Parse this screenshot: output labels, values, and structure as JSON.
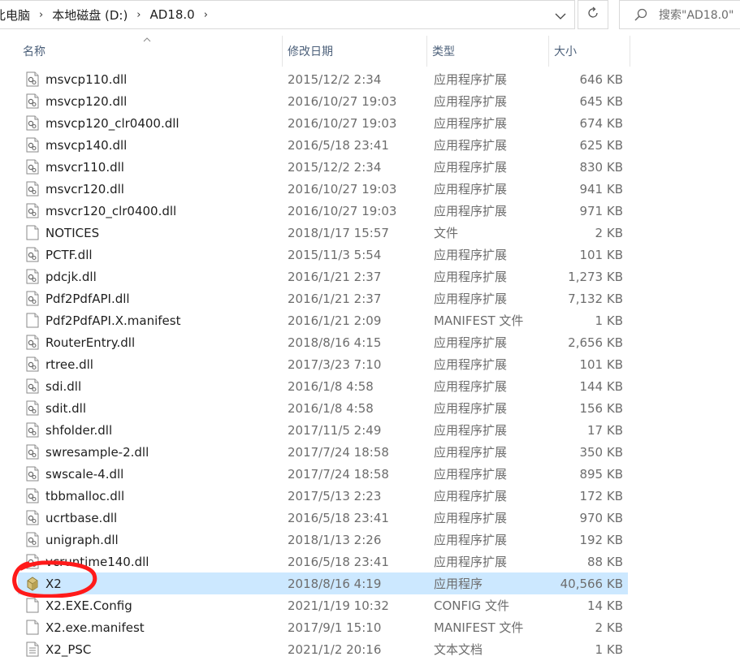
{
  "address": {
    "crumbs": [
      "此电脑",
      "本地磁盘 (D:)",
      "AD18.0"
    ],
    "separator": "›",
    "dropdown_icon": "chevron-down-icon",
    "refresh_icon": "refresh-icon"
  },
  "search": {
    "placeholder": "搜索\"AD18.0\""
  },
  "columns": {
    "name": "名称",
    "date": "修改日期",
    "type": "类型",
    "size": "大小"
  },
  "files": [
    {
      "name": "msvcp110.dll",
      "date": "2015/12/2 2:34",
      "type": "应用程序扩展",
      "size": "646 KB",
      "icon": "dll-file-icon"
    },
    {
      "name": "msvcp120.dll",
      "date": "2016/10/27 19:03",
      "type": "应用程序扩展",
      "size": "645 KB",
      "icon": "dll-file-icon"
    },
    {
      "name": "msvcp120_clr0400.dll",
      "date": "2016/10/27 19:03",
      "type": "应用程序扩展",
      "size": "674 KB",
      "icon": "dll-file-icon"
    },
    {
      "name": "msvcp140.dll",
      "date": "2016/5/18 23:41",
      "type": "应用程序扩展",
      "size": "625 KB",
      "icon": "dll-file-icon"
    },
    {
      "name": "msvcr110.dll",
      "date": "2015/12/2 2:34",
      "type": "应用程序扩展",
      "size": "830 KB",
      "icon": "dll-file-icon"
    },
    {
      "name": "msvcr120.dll",
      "date": "2016/10/27 19:03",
      "type": "应用程序扩展",
      "size": "941 KB",
      "icon": "dll-file-icon"
    },
    {
      "name": "msvcr120_clr0400.dll",
      "date": "2016/10/27 19:03",
      "type": "应用程序扩展",
      "size": "971 KB",
      "icon": "dll-file-icon"
    },
    {
      "name": "NOTICES",
      "date": "2018/1/17 15:57",
      "type": "文件",
      "size": "2 KB",
      "icon": "blank-file-icon"
    },
    {
      "name": "PCTF.dll",
      "date": "2015/11/3 5:54",
      "type": "应用程序扩展",
      "size": "101 KB",
      "icon": "dll-file-icon"
    },
    {
      "name": "pdcjk.dll",
      "date": "2016/1/21 2:37",
      "type": "应用程序扩展",
      "size": "1,273 KB",
      "icon": "dll-file-icon"
    },
    {
      "name": "Pdf2PdfAPI.dll",
      "date": "2016/1/21 2:37",
      "type": "应用程序扩展",
      "size": "7,132 KB",
      "icon": "dll-file-icon"
    },
    {
      "name": "Pdf2PdfAPI.X.manifest",
      "date": "2016/1/21 2:09",
      "type": "MANIFEST 文件",
      "size": "1 KB",
      "icon": "blank-file-icon"
    },
    {
      "name": "RouterEntry.dll",
      "date": "2018/8/16 4:15",
      "type": "应用程序扩展",
      "size": "2,656 KB",
      "icon": "dll-file-icon"
    },
    {
      "name": "rtree.dll",
      "date": "2017/3/23 7:10",
      "type": "应用程序扩展",
      "size": "101 KB",
      "icon": "dll-file-icon"
    },
    {
      "name": "sdi.dll",
      "date": "2016/1/8 4:58",
      "type": "应用程序扩展",
      "size": "144 KB",
      "icon": "dll-file-icon"
    },
    {
      "name": "sdit.dll",
      "date": "2016/1/8 4:58",
      "type": "应用程序扩展",
      "size": "156 KB",
      "icon": "dll-file-icon"
    },
    {
      "name": "shfolder.dll",
      "date": "2017/11/5 2:49",
      "type": "应用程序扩展",
      "size": "17 KB",
      "icon": "dll-file-icon"
    },
    {
      "name": "swresample-2.dll",
      "date": "2017/7/24 18:58",
      "type": "应用程序扩展",
      "size": "350 KB",
      "icon": "dll-file-icon"
    },
    {
      "name": "swscale-4.dll",
      "date": "2017/7/24 18:58",
      "type": "应用程序扩展",
      "size": "895 KB",
      "icon": "dll-file-icon"
    },
    {
      "name": "tbbmalloc.dll",
      "date": "2017/5/13 2:23",
      "type": "应用程序扩展",
      "size": "172 KB",
      "icon": "dll-file-icon"
    },
    {
      "name": "ucrtbase.dll",
      "date": "2016/5/18 23:41",
      "type": "应用程序扩展",
      "size": "970 KB",
      "icon": "dll-file-icon"
    },
    {
      "name": "unigraph.dll",
      "date": "2018/1/13 2:26",
      "type": "应用程序扩展",
      "size": "192 KB",
      "icon": "dll-file-icon"
    },
    {
      "name": "vcruntime140.dll",
      "date": "2016/5/18 23:41",
      "type": "应用程序扩展",
      "size": "88 KB",
      "icon": "dll-file-icon"
    },
    {
      "name": "X2",
      "date": "2018/8/16 4:19",
      "type": "应用程序",
      "size": "40,566 KB",
      "icon": "app-exe-icon",
      "selected": true
    },
    {
      "name": "X2.EXE.Config",
      "date": "2021/1/19 10:32",
      "type": "CONFIG 文件",
      "size": "14 KB",
      "icon": "blank-file-icon"
    },
    {
      "name": "X2.exe.manifest",
      "date": "2017/9/1 15:10",
      "type": "MANIFEST 文件",
      "size": "2 KB",
      "icon": "blank-file-icon"
    },
    {
      "name": "X2_PSC",
      "date": "2021/1/2 20:16",
      "type": "文本文档",
      "size": "1 KB",
      "icon": "text-file-icon"
    }
  ],
  "colors": {
    "selection": "#cce8ff",
    "annotation": "#ff0000",
    "header_text": "#4c607a"
  }
}
